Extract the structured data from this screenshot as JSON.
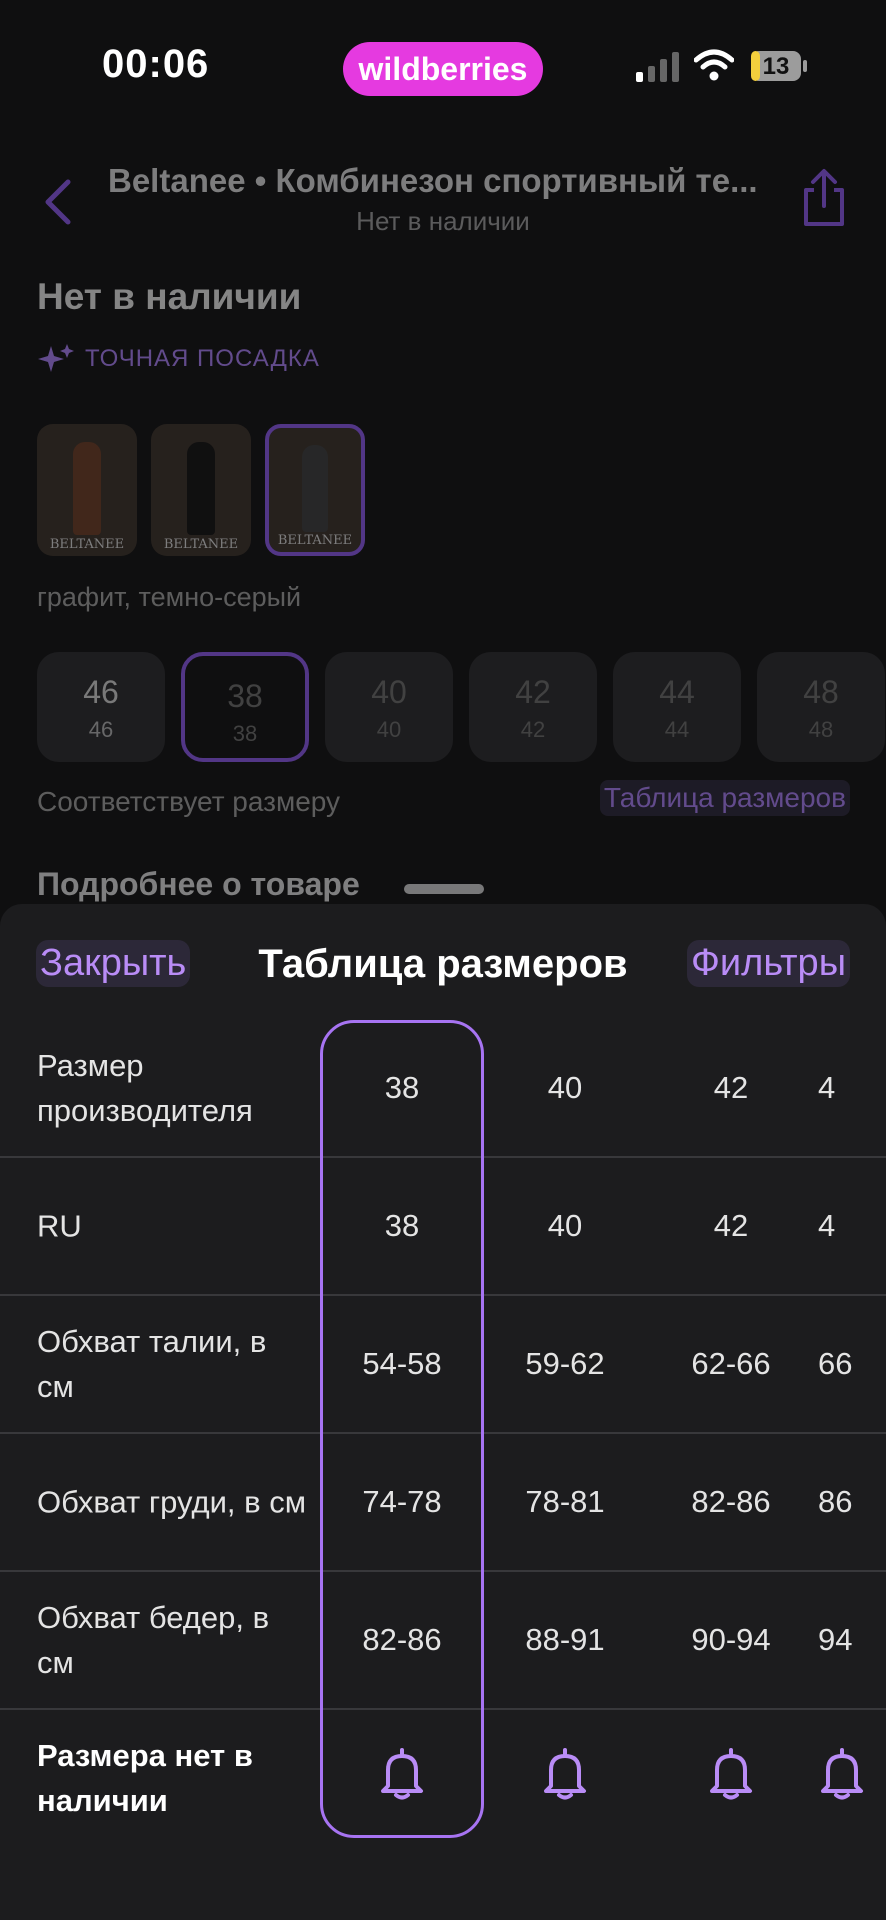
{
  "status_bar": {
    "time": "00:06",
    "brand": "wildberries",
    "battery": "13",
    "brand_color": "#e53ae0"
  },
  "page": {
    "header_title": "Beltanee • Комбинезон спортивный те...",
    "header_subtitle": "Нет в наличии",
    "stock_title": "Нет в наличии",
    "fit_label": "ТОЧНАЯ ПОСАДКА",
    "thumbnail_watermark": "BELTANEE",
    "color_name": "графит, темно-серый",
    "sizes": [
      {
        "top": "46",
        "bottom": "46",
        "state": "normal"
      },
      {
        "top": "38",
        "bottom": "38",
        "state": "selected"
      },
      {
        "top": "40",
        "bottom": "40",
        "state": "dim"
      },
      {
        "top": "42",
        "bottom": "42",
        "state": "dim"
      },
      {
        "top": "44",
        "bottom": "44",
        "state": "dim"
      },
      {
        "top": "48",
        "bottom": "48",
        "state": "dim"
      }
    ],
    "fits_text": "Соответствует размеру",
    "size_table_link": "Таблица размеров",
    "more_label": "Подробнее о товаре"
  },
  "sheet": {
    "close_label": "Закрыть",
    "title": "Таблица размеров",
    "filter_label": "Фильтры",
    "accent": "#a774f2",
    "rows": [
      {
        "label": "Размер производителя",
        "values": [
          "38",
          "40",
          "42",
          "4"
        ]
      },
      {
        "label": "RU",
        "values": [
          "38",
          "40",
          "42",
          "4"
        ]
      },
      {
        "label": "Обхват талии, в см",
        "values": [
          "54-58",
          "59-62",
          "62-66",
          "66"
        ]
      },
      {
        "label": "Обхват груди, в см",
        "values": [
          "74-78",
          "78-81",
          "82-86",
          "86"
        ]
      },
      {
        "label": "Обхват бедер, в см",
        "values": [
          "82-86",
          "88-91",
          "90-94",
          "94"
        ]
      },
      {
        "label": "Размера нет в наличии",
        "values": [
          "bell-icon",
          "bell-icon",
          "bell-icon",
          "bell-icon"
        ]
      }
    ]
  }
}
